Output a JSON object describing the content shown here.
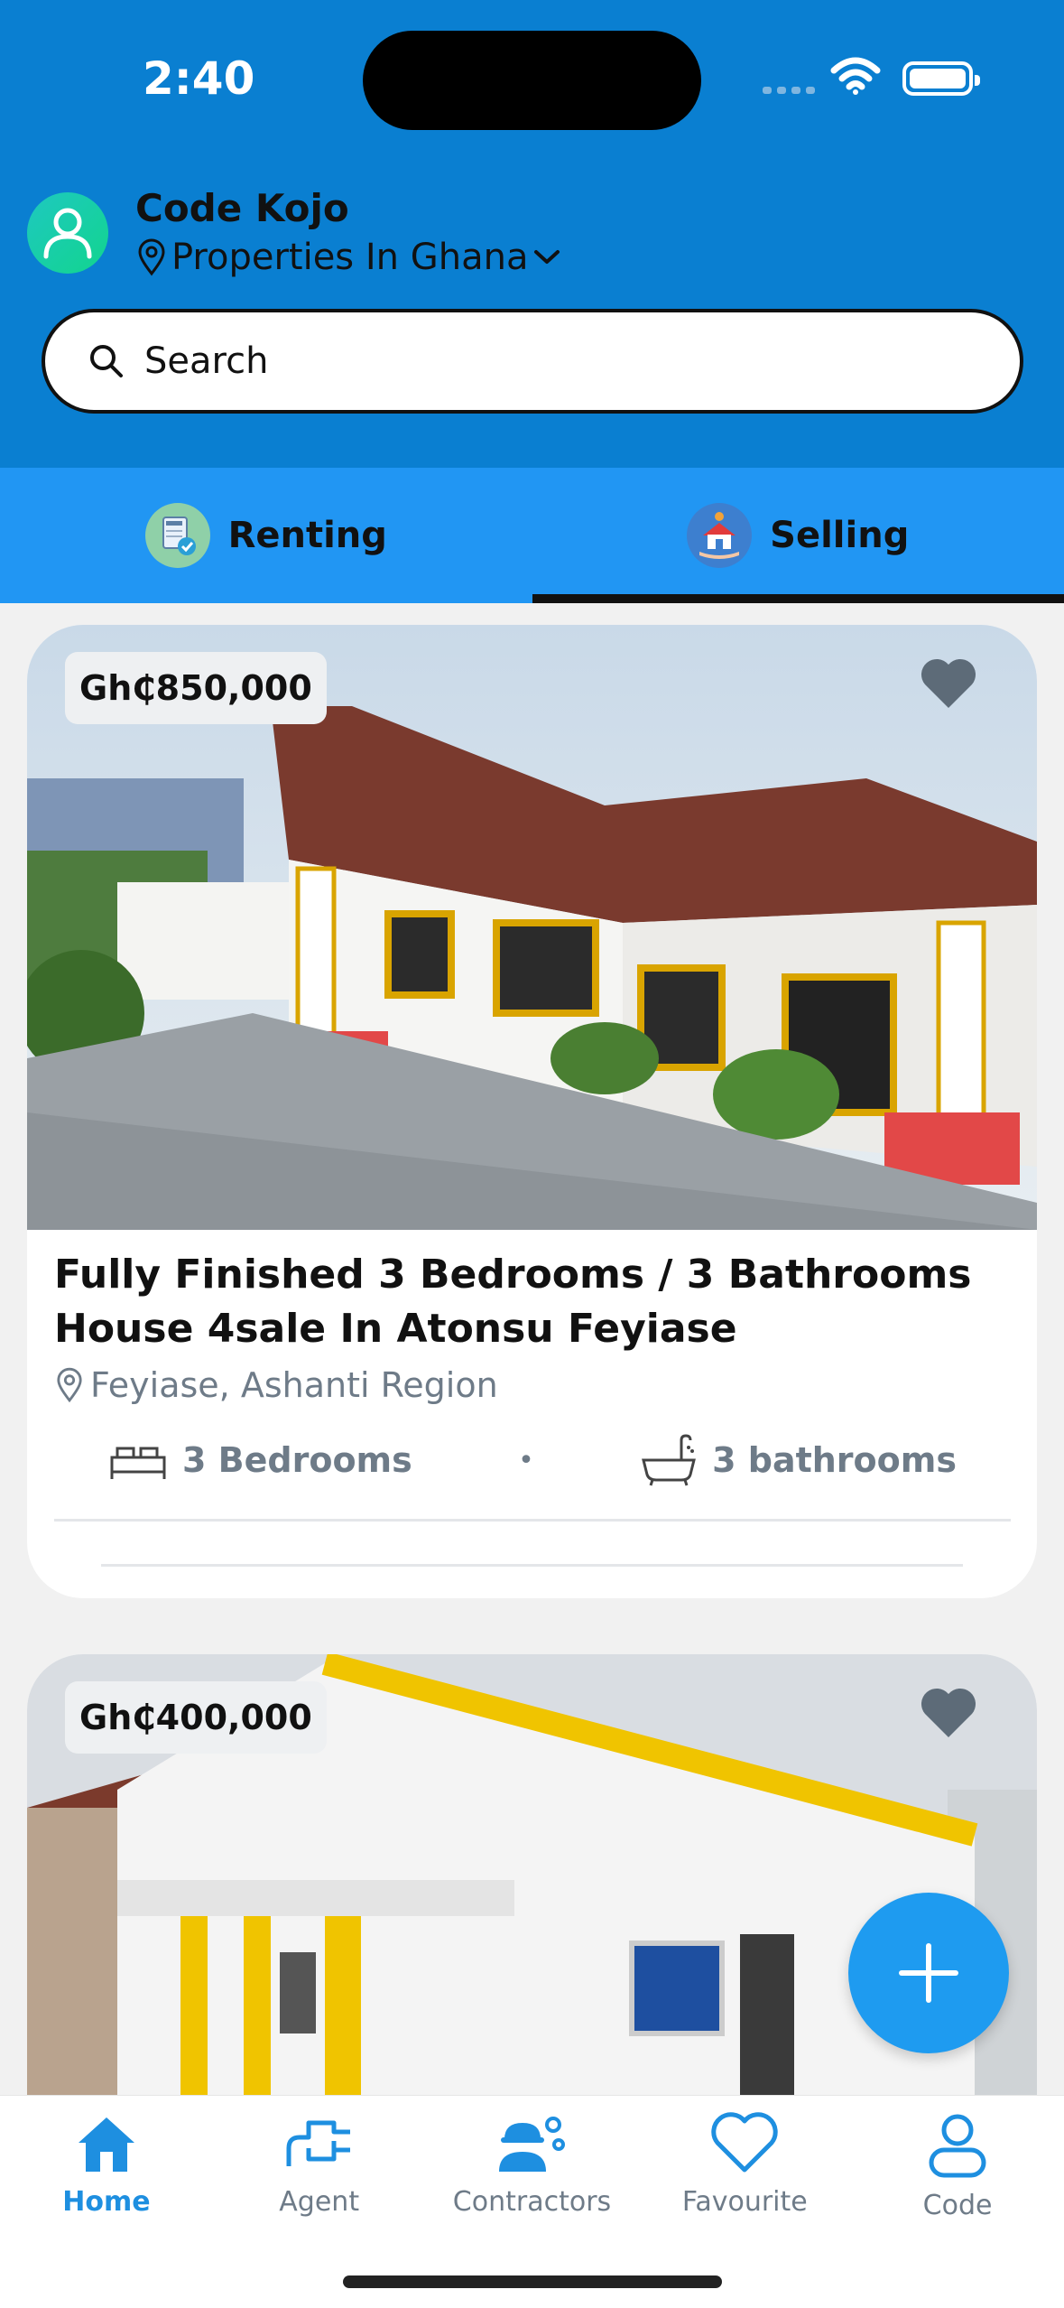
{
  "status_bar": {
    "time": "2:40"
  },
  "header": {
    "user_name": "Code Kojo",
    "location_selector": "Properties In Ghana",
    "search_placeholder": "Search"
  },
  "tabs": [
    {
      "label": "Renting",
      "active": false,
      "icon": "rent-document-icon"
    },
    {
      "label": "Selling",
      "active": true,
      "icon": "house-hand-icon"
    }
  ],
  "listings": [
    {
      "price": "Gh₵850,000",
      "title": "Fully Finished 3 Bedrooms / 3 Bathrooms House 4sale In Atonsu Feyiase",
      "location": "Feyiase, Ashanti Region",
      "bedrooms": "3 Bedrooms",
      "bathrooms": "3 bathrooms",
      "separator": "•"
    },
    {
      "price": "Gh₵400,000"
    }
  ],
  "bottom_nav": [
    {
      "label": "Home",
      "icon": "home-icon",
      "active": true
    },
    {
      "label": "Agent",
      "icon": "agent-plug-icon",
      "active": false
    },
    {
      "label": "Contractors",
      "icon": "contractor-icon",
      "active": false
    },
    {
      "label": "Favourite",
      "icon": "heart-icon",
      "active": false
    },
    {
      "label": "Code",
      "icon": "profile-icon",
      "active": false
    }
  ],
  "colors": {
    "header_bg": "#0a7fd1",
    "tab_bg": "#2196f3",
    "accent": "#1e9bf0",
    "muted_text": "#6e7b88"
  }
}
